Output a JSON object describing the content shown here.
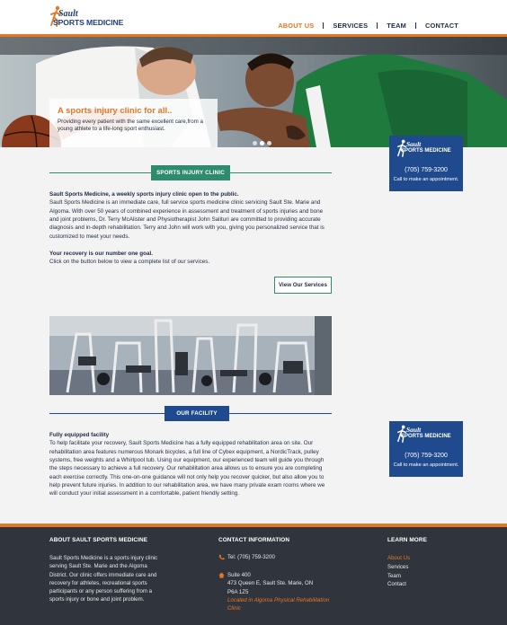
{
  "brand": {
    "top": "Sault",
    "bottom": "SPORTS MEDICINE"
  },
  "nav": [
    {
      "label": "ABOUT US",
      "active": true
    },
    {
      "label": "SERVICES",
      "active": false
    },
    {
      "label": "TEAM",
      "active": false
    },
    {
      "label": "CONTACT",
      "active": false
    }
  ],
  "hero": {
    "title": "A sports injury clinic for all..",
    "text": "Providing every patient with the same excellent care,from a young athlete to a life-long sport enthusiast.",
    "slides": 3,
    "active_slide": 2
  },
  "side_card": {
    "top": "Sault",
    "bottom": "SPORTS MEDICINE",
    "phone": "(705) 759-3200",
    "cta": "Call to make an appointment."
  },
  "injury_section": {
    "label": "SPORTS INJURY CLINIC",
    "intro_bold": "Sault Sports Medicine, a weekly sports injury clinic open to the public.",
    "intro_text": "Sault Sports Medicine is an immediate care, full service sports medicine clinic servicing Sault Ste. Marie and Algoma. With over 50 years of combined experience in assessment and treatment of sports injuries and bone and joint problems, Dr. Terry McAlister and Physiotherapist John Salituri are committed to providing accurate diagnosis and in-depth rehabilitation. Terry and John will work with you, giving you personalized service that is customized to meet your needs.",
    "goal_bold": "Your recovery is our number one goal.",
    "goal_text": "Click on the button below to view a complete list of our services.",
    "button": "View Our Services"
  },
  "facility_section": {
    "label": "OUR FACILITY",
    "heading": "Fully equipped facility",
    "text": "To help facilitate your recovery, Sault Sports Medicine has a fully equipped rehabilitation area on site. Our rehabilitation area features numerous Monark bicycles, a full line of Cybex equipment, a NordicTrack, pulley systems, free weights and a Whirlpool tub. Using our equipment, our experienced team will guide you through the steps necessary to achieve a full recovery. Our rehabilitation area allows us to ensure you are completing each exercise correctly. This one-on-one guidance will not only help you recover quicker, but also allow you to help prevent future injuries. In addition to our rehabilitation area, we have many private exam rooms where we will conduct your initial assessment in a comfortable, patient friendly setting."
  },
  "footer": {
    "about_head": "ABOUT SAULT SPORTS MEDICINE",
    "about_text": "Sault Sports Medicine is a sports injury clinic serving Sault Ste. Marie and the Algoma District. Our clinic offers immediate care and recovery for athletes, recreational sports participants or any person suffering from a sports injury or bone and joint problem.",
    "contact_head": "CONTACT INFORMATION",
    "tel": "Tel: (705) 759-3200",
    "address_line1": "Suite 400",
    "address_line2": "473 Queen E, Sault Ste. Marie, ON",
    "address_line3": "P6A 1Z5",
    "location_link": "Located in Algoma Physical Rehabilitation Clinic",
    "learn_head": "LEARN MORE",
    "learn_links": [
      {
        "label": "About Us",
        "active": true
      },
      {
        "label": "Services",
        "active": false
      },
      {
        "label": "Team",
        "active": false
      },
      {
        "label": "Contact",
        "active": false
      }
    ]
  },
  "colors": {
    "accent_orange": "#e57624",
    "brand_blue": "#1f4b8e",
    "injury_green": "#2e8b6e",
    "facility_blue": "#1f4b8e",
    "footer_bg": "#30353d"
  }
}
